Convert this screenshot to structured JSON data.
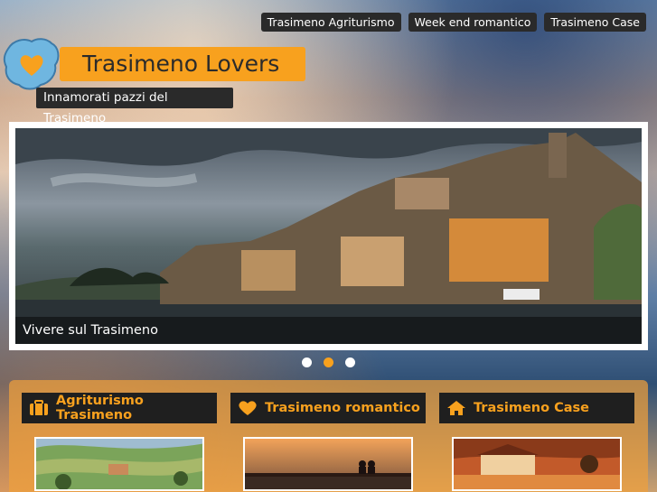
{
  "nav": [
    {
      "label": "Trasimeno Agriturismo"
    },
    {
      "label": "Week end romantico"
    },
    {
      "label": "Trasimeno Case"
    }
  ],
  "brand": {
    "title": "Trasimeno Lovers",
    "tagline": "Innamorati pazzi del Trasimeno"
  },
  "slider": {
    "caption": "Vivere sul Trasimeno",
    "active_index": 1,
    "count": 3
  },
  "cards": [
    {
      "title": "Agriturismo Trasimeno",
      "icon": "suitcase-icon"
    },
    {
      "title": "Trasimeno romantico",
      "icon": "heart-icon"
    },
    {
      "title": "Trasimeno Case",
      "icon": "home-icon"
    }
  ],
  "colors": {
    "accent": "#f8a11e",
    "dark": "#2a2a2a"
  }
}
